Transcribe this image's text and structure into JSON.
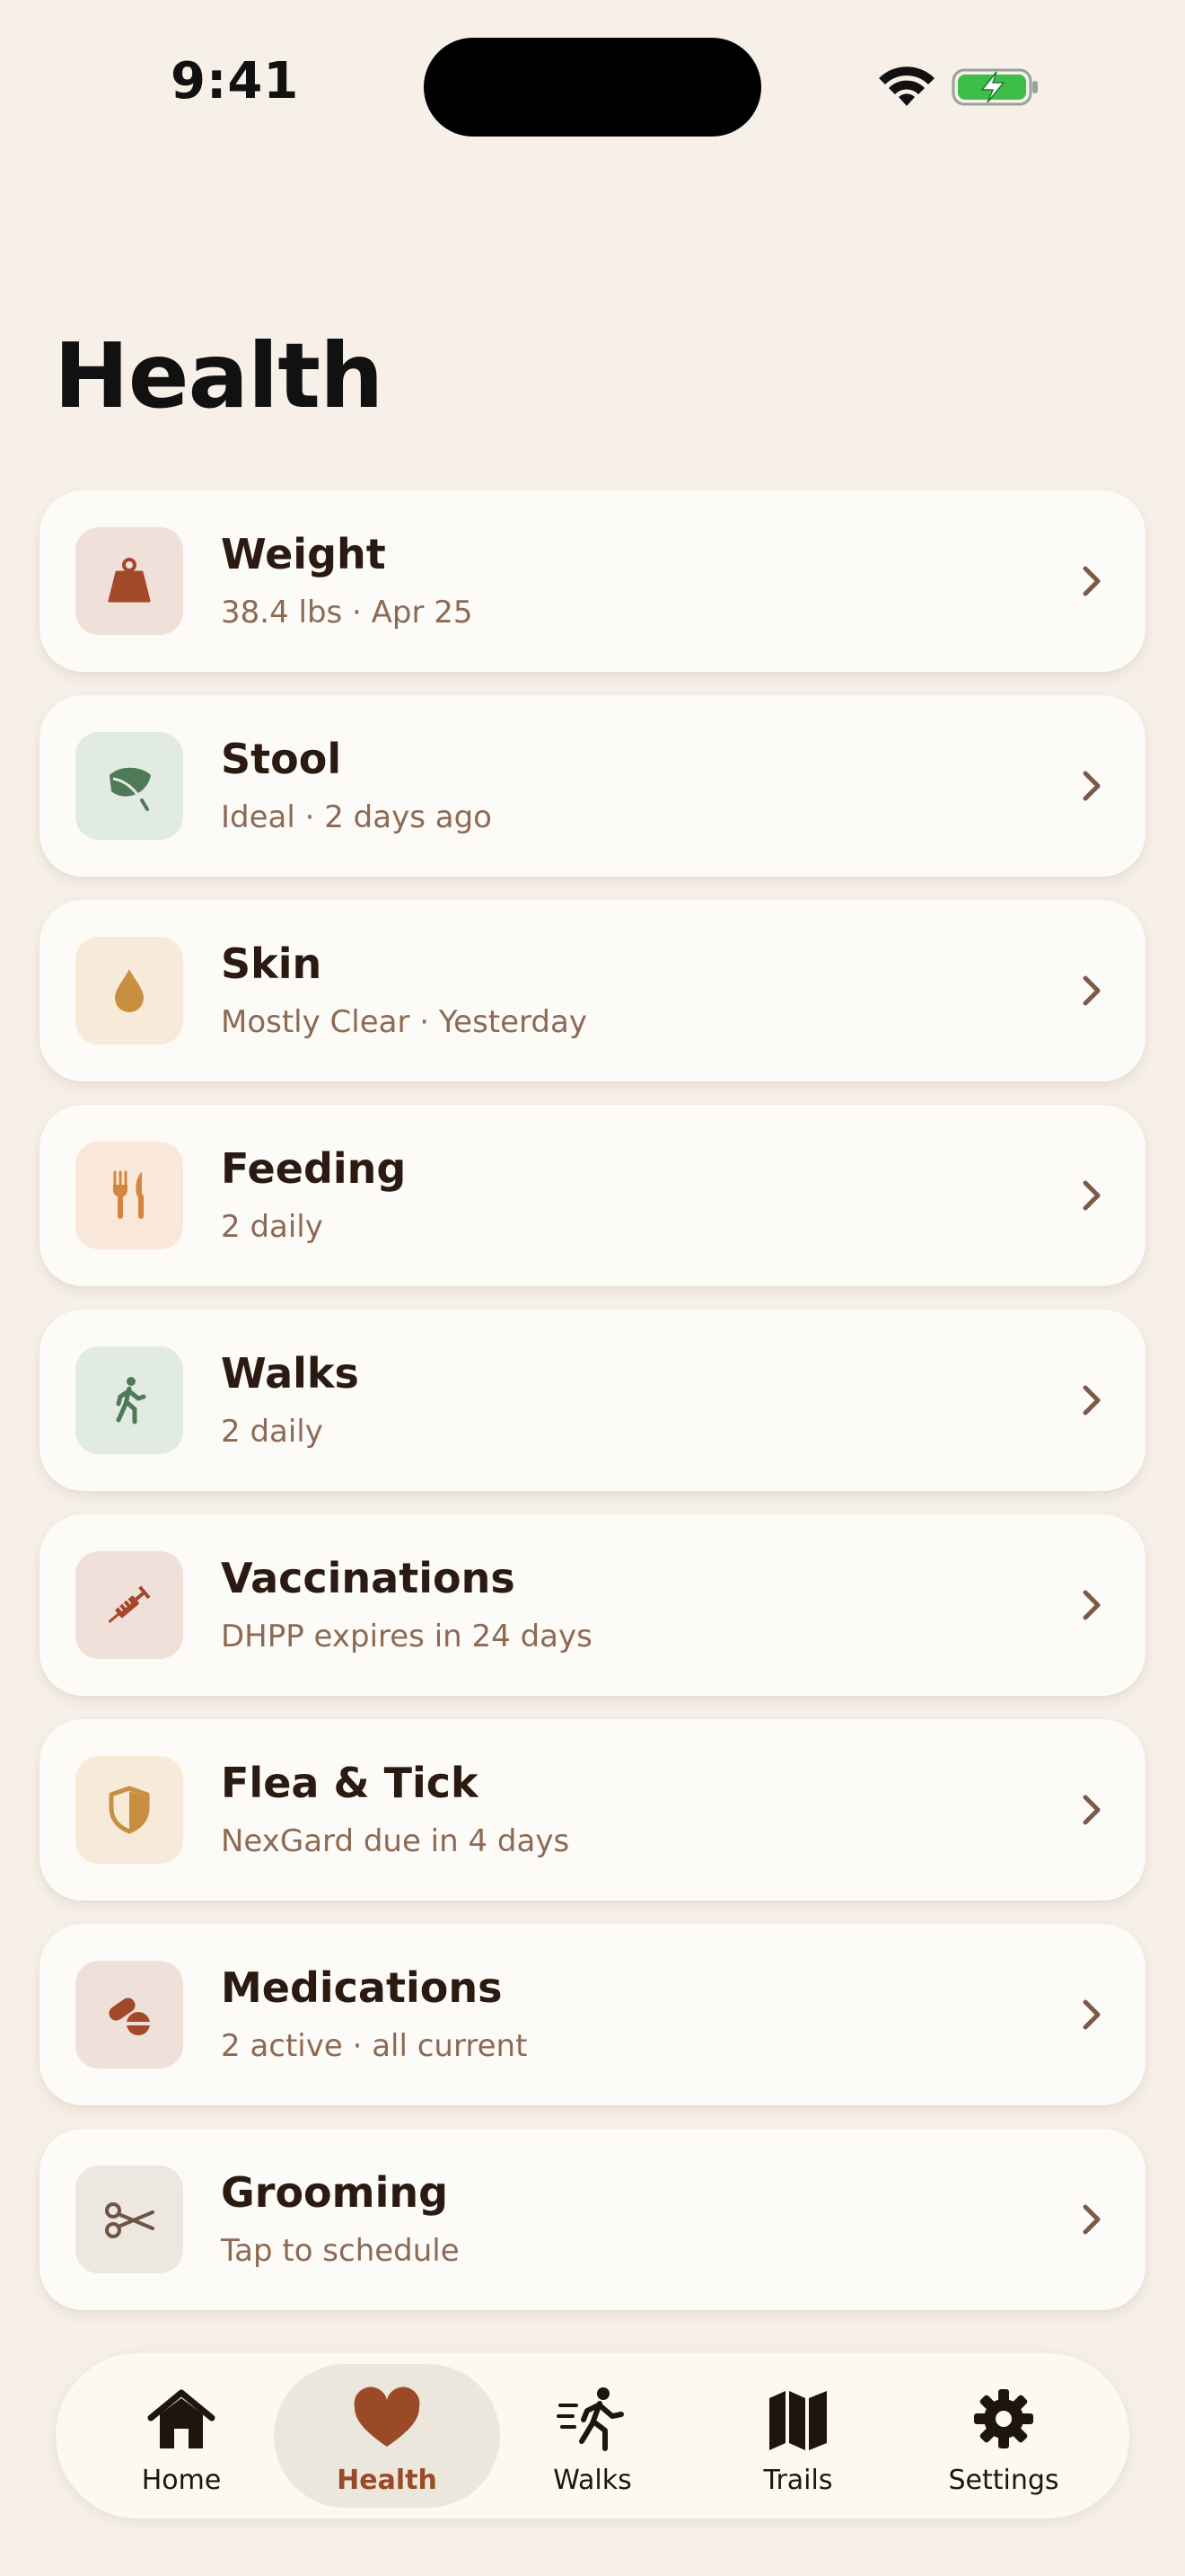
{
  "status_bar": {
    "time": "9:41"
  },
  "page": {
    "title": "Health"
  },
  "health_items": [
    {
      "title": "Weight",
      "subtitle": "38.4 lbs · Apr 25",
      "icon": "weight-icon",
      "tile_color": "#F0E0DA",
      "icon_color": "#A4482A"
    },
    {
      "title": "Stool",
      "subtitle": "Ideal · 2 days ago",
      "icon": "leaf-icon",
      "tile_color": "#E2EBE2",
      "icon_color": "#4E7A58"
    },
    {
      "title": "Skin",
      "subtitle": "Mostly Clear · Yesterday",
      "icon": "droplet-icon",
      "tile_color": "#F7EAD8",
      "icon_color": "#C78F3F"
    },
    {
      "title": "Feeding",
      "subtitle": "2 daily",
      "icon": "utensils-icon",
      "tile_color": "#F9E8D9",
      "icon_color": "#D4863E"
    },
    {
      "title": "Walks",
      "subtitle": "2 daily",
      "icon": "walker-icon",
      "tile_color": "#E2EBE2",
      "icon_color": "#4E7A58"
    },
    {
      "title": "Vaccinations",
      "subtitle": "DHPP expires in 24 days",
      "icon": "syringe-icon",
      "tile_color": "#F0E0DA",
      "icon_color": "#A4482A"
    },
    {
      "title": "Flea & Tick",
      "subtitle": "NexGard due in 4 days",
      "icon": "shield-icon",
      "tile_color": "#F7EAD8",
      "icon_color": "#C78F3F"
    },
    {
      "title": "Medications",
      "subtitle": "2 active · all current",
      "icon": "pills-icon",
      "tile_color": "#F0E0DA",
      "icon_color": "#A4482A"
    },
    {
      "title": "Grooming",
      "subtitle": "Tap to schedule",
      "icon": "scissors-icon",
      "tile_color": "#ECE7DF",
      "icon_color": "#6E5446"
    }
  ],
  "tab_bar": {
    "active": "Health",
    "tabs": [
      {
        "label": "Home",
        "icon": "house-icon"
      },
      {
        "label": "Health",
        "icon": "heart-icon"
      },
      {
        "label": "Walks",
        "icon": "running-person-icon"
      },
      {
        "label": "Trails",
        "icon": "map-icon"
      },
      {
        "label": "Settings",
        "icon": "gear-icon"
      }
    ]
  },
  "colors": {
    "background": "#F6F0E8",
    "card": "#FDFBF7",
    "accent": "#9A4A26",
    "subtitle": "#8C6A55",
    "chevron": "#7A5A48"
  }
}
